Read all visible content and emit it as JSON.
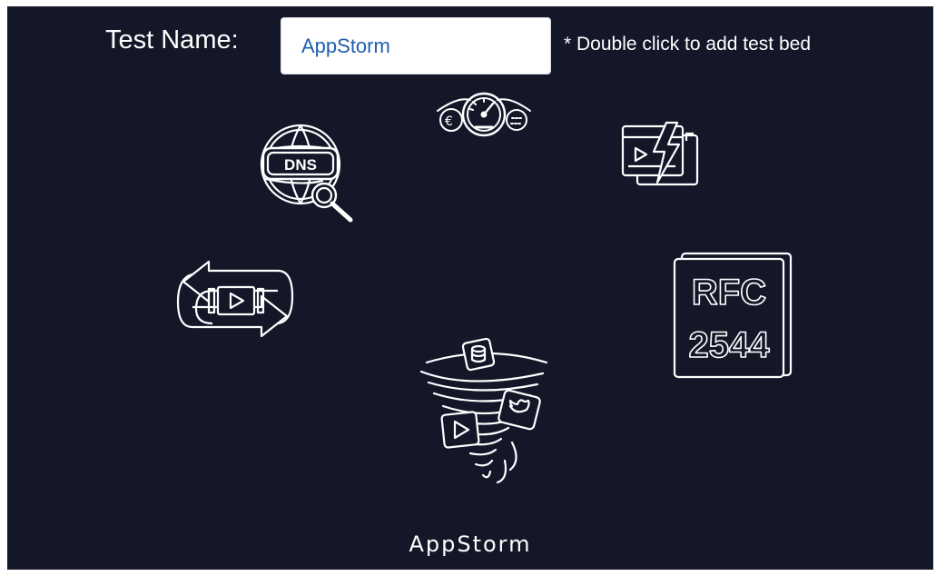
{
  "form": {
    "label": "Test Name:",
    "value": "AppStorm",
    "hint": "* Double click to add test bed"
  },
  "icons": {
    "dns": {
      "name": "dns-lookup-icon",
      "text": "DNS"
    },
    "speed": {
      "name": "speedometer-icon"
    },
    "video": {
      "name": "video-flash-icon"
    },
    "replay": {
      "name": "video-loop-icon"
    },
    "rfc": {
      "name": "rfc-2544-icon",
      "line1": "RFC",
      "line2": "2544"
    },
    "storm": {
      "name": "app-storm-icon"
    }
  },
  "footer": {
    "title": "AppStorm"
  },
  "colors": {
    "background": "#131728",
    "foreground": "#ffffff",
    "input_text": "#1f5fae"
  }
}
